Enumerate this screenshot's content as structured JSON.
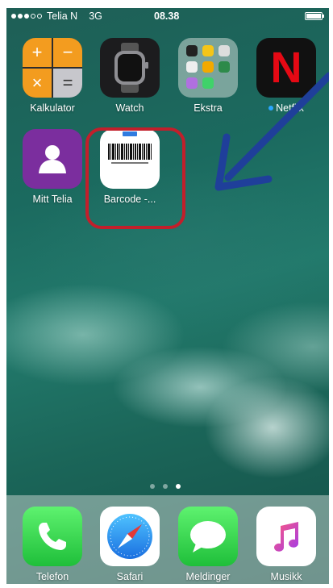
{
  "status_bar": {
    "carrier": "Telia N",
    "network": "3G",
    "time": "08.38"
  },
  "apps": [
    {
      "label": "Kalkulator",
      "icon": "calculator-icon"
    },
    {
      "label": "Watch",
      "icon": "watch-icon"
    },
    {
      "label": "Ekstra",
      "icon": "folder-icon"
    },
    {
      "label": "Netflix",
      "icon": "netflix-icon"
    },
    {
      "label": "Mitt Telia",
      "icon": "person-icon"
    },
    {
      "label": "Barcode -...",
      "icon": "barcode-icon"
    }
  ],
  "calculator_symbols": [
    "+",
    "−",
    "×",
    "="
  ],
  "netflix_letter": "N",
  "page_indicator": {
    "count": 3,
    "active": 3
  },
  "dock": [
    {
      "label": "Telefon",
      "icon": "phone-icon"
    },
    {
      "label": "Safari",
      "icon": "compass-icon"
    },
    {
      "label": "Meldinger",
      "icon": "speech-bubble-icon"
    },
    {
      "label": "Musikk",
      "icon": "music-note-icon"
    }
  ],
  "colors": {
    "highlight": "#c21f2b",
    "arrow": "#1f3f9a",
    "calculator_orange": "#f39c1f",
    "telia_purple": "#7b2e9e",
    "netflix_red": "#e50914"
  }
}
